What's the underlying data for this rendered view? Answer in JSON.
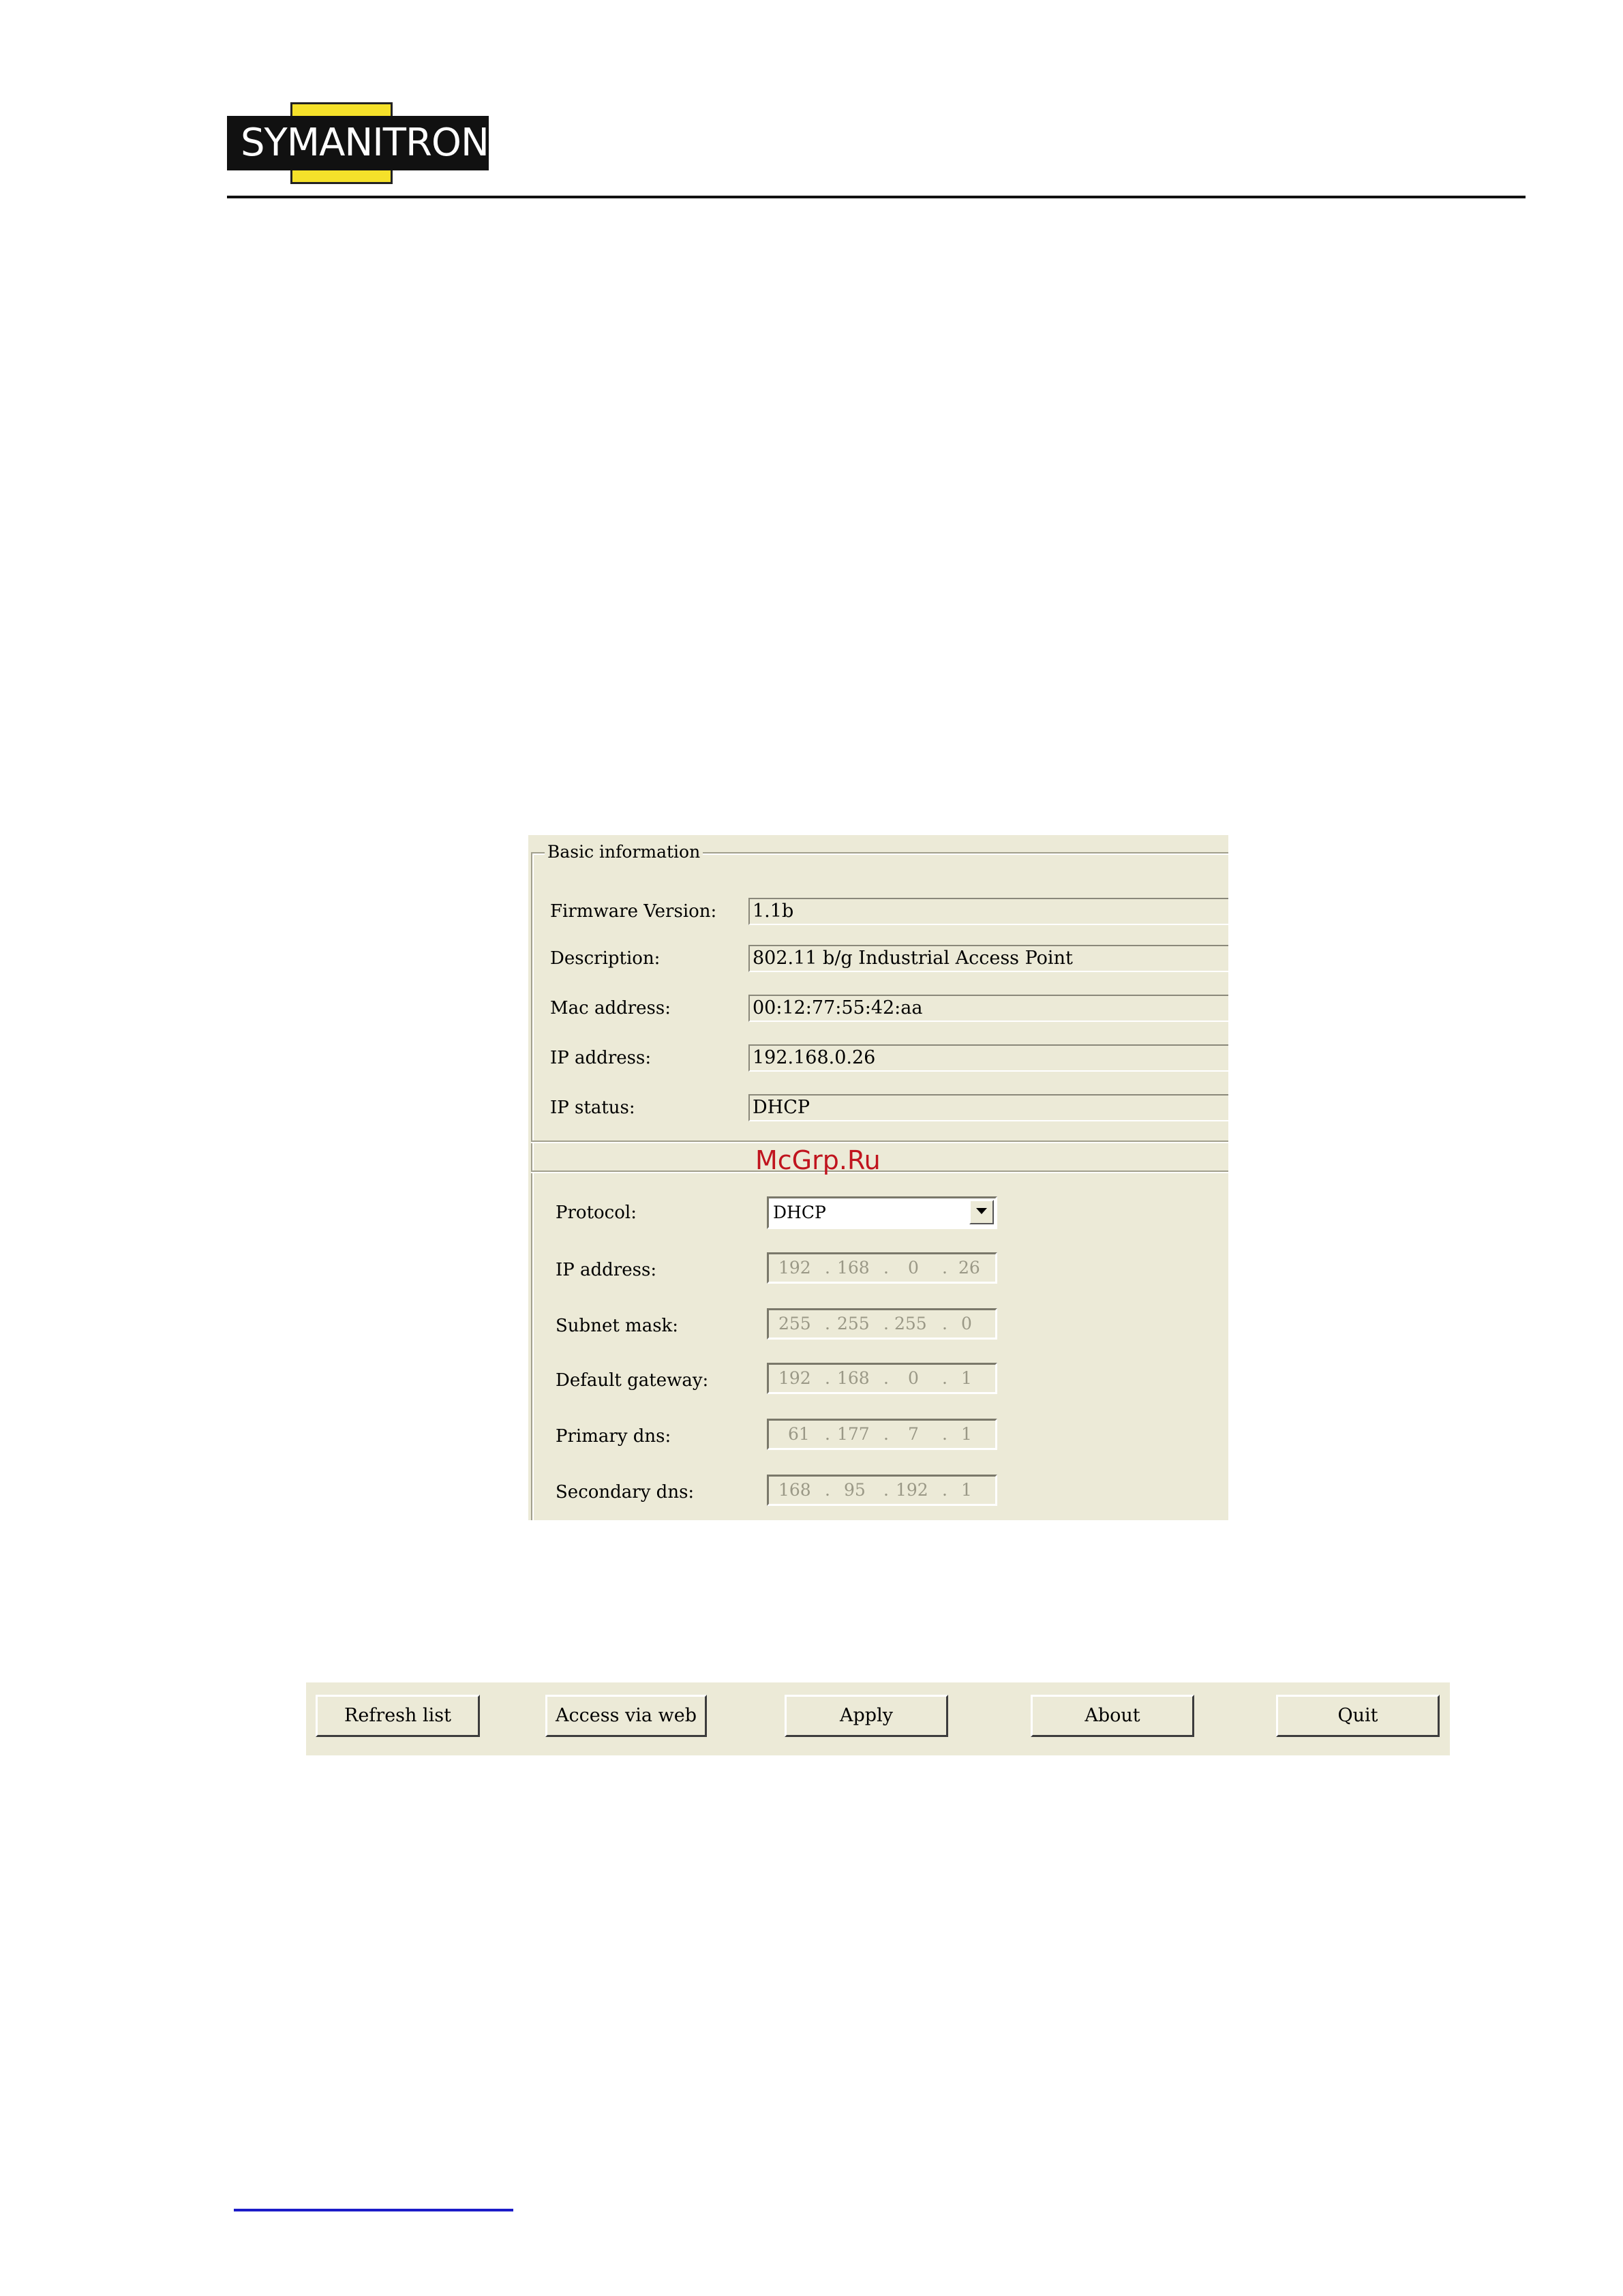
{
  "logo": {
    "text": "SYMANITRON"
  },
  "basic_info": {
    "legend": "Basic information",
    "fields": [
      {
        "label": "Firmware Version:",
        "value": "1.1b"
      },
      {
        "label": "Description:",
        "value": "802.11 b/g Industrial Access Point"
      },
      {
        "label": "Mac address:",
        "value": "00:12:77:55:42:aa"
      },
      {
        "label": "IP address:",
        "value": "192.168.0.26"
      },
      {
        "label": "IP status:",
        "value": "DHCP"
      }
    ]
  },
  "watermark": "McGrp.Ru",
  "network": {
    "protocol_label": "Protocol:",
    "protocol_value": "DHCP",
    "fields": [
      {
        "label": "IP address:",
        "octets": [
          "192",
          "168",
          "0",
          "26"
        ]
      },
      {
        "label": "Subnet mask:",
        "octets": [
          "255",
          "255",
          "255",
          "0"
        ]
      },
      {
        "label": "Default gateway:",
        "octets": [
          "192",
          "168",
          "0",
          "1"
        ]
      },
      {
        "label": "Primary dns:",
        "octets": [
          "61",
          "177",
          "7",
          "1"
        ]
      },
      {
        "label": "Secondary dns:",
        "octets": [
          "168",
          "95",
          "192",
          "1"
        ]
      }
    ]
  },
  "buttons": {
    "refresh": "Refresh list",
    "web": "Access via web",
    "apply": "Apply",
    "about": "About",
    "quit": "Quit"
  }
}
